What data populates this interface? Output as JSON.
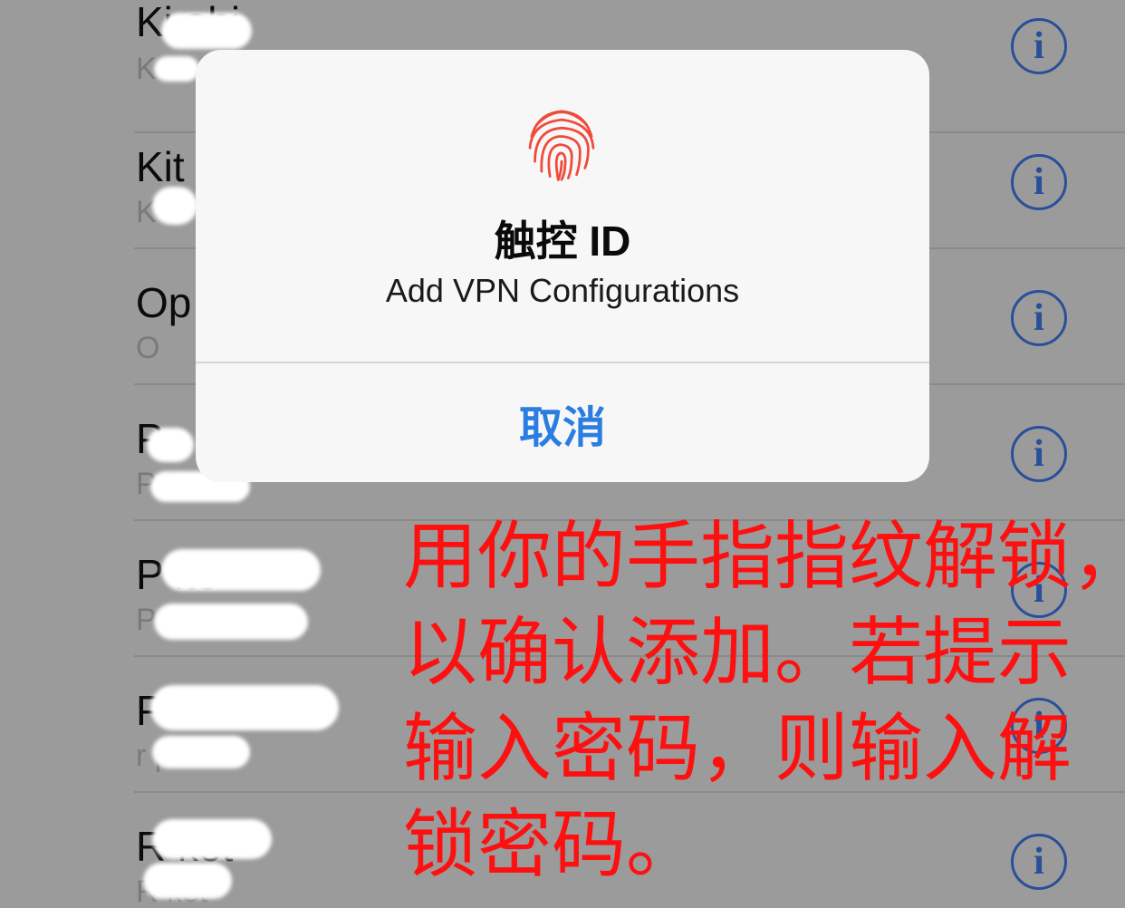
{
  "vpn_list": {
    "rows": [
      {
        "title": "Ki        ebi",
        "subtitle": "K"
      },
      {
        "title": "Kit",
        "subtitle": "K"
      },
      {
        "title": "Op",
        "subtitle": "O"
      },
      {
        "title": "P",
        "subtitle": "P              2"
      },
      {
        "title": "P                    ite",
        "subtitle": "P                 e"
      },
      {
        "title": "P                    N",
        "subtitle": "r              p"
      },
      {
        "title": "R        ket",
        "subtitle": "R      ket"
      }
    ],
    "info_icon": "info-circle-icon",
    "info_glyph": "i"
  },
  "dialog": {
    "icon": "fingerprint-icon",
    "title": "触控 ID",
    "message": "Add VPN Configurations",
    "cancel_label": "取消"
  },
  "annotation": {
    "lines": [
      "用你的手指指纹解锁，",
      "以确认添加。若提示",
      "输入密码，则输入解",
      "锁密码。"
    ]
  },
  "colors": {
    "background": "#9b9b9b",
    "accent": "#2a7de1",
    "annotation": "#ff1010",
    "info_icon": "#2a4f9a"
  }
}
